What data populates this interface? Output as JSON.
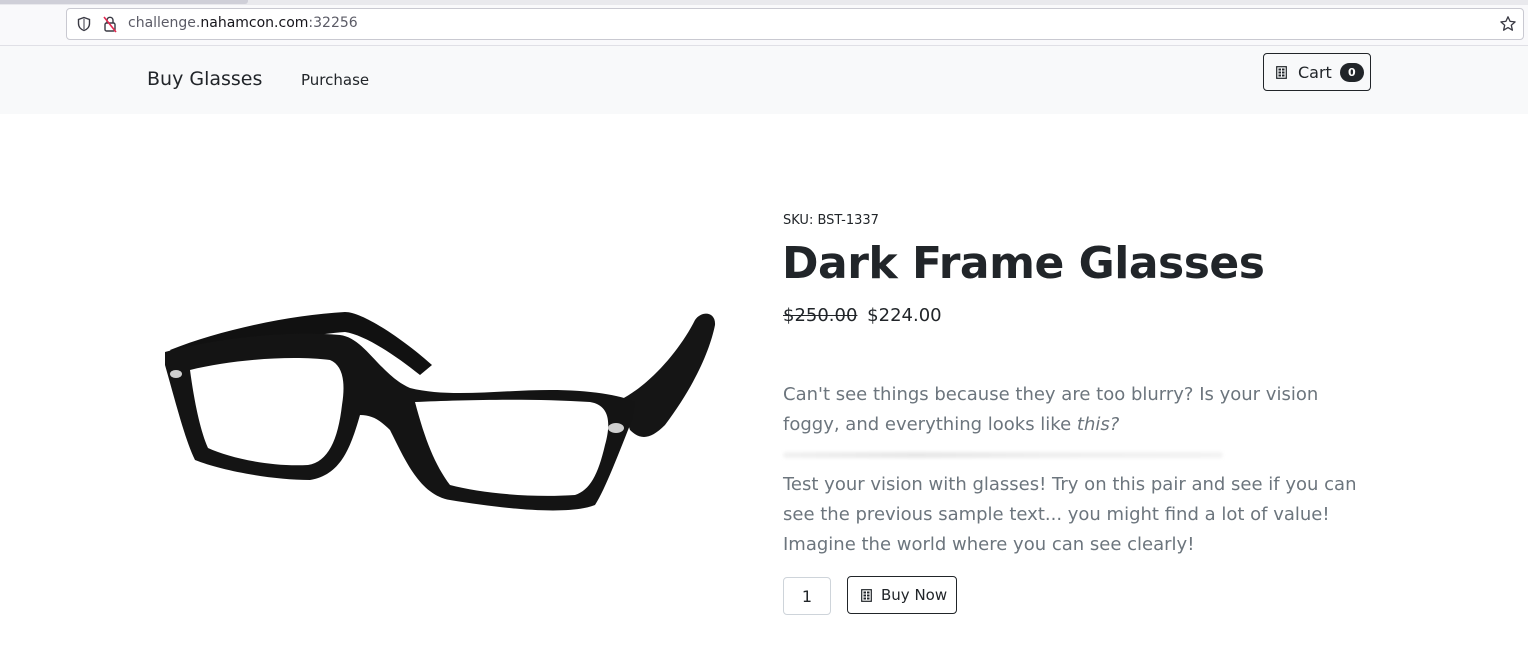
{
  "browser": {
    "url_prefix": "challenge.",
    "url_host": "nahamcon.com",
    "url_suffix": ":32256"
  },
  "navbar": {
    "brand": "Buy Glasses",
    "purchase_link": "Purchase",
    "cart_label": "Cart",
    "cart_count": "0"
  },
  "product": {
    "sku": "SKU: BST-1337",
    "title": "Dark Frame Glasses",
    "old_price": "$250.00",
    "price": "$224.00",
    "description_1_text": "Can't see things because they are too blurry? Is your vision foggy, and everything looks like ",
    "description_1_emph": "this?",
    "description_2": "Test your vision with glasses! Try on this pair and see if you can see the previous sample text... you might find a lot of value! Imagine the world where you can see clearly!",
    "quantity": "1",
    "buy_label": "Buy Now"
  },
  "colors": {
    "text": "#212529",
    "muted": "#6c757d",
    "navbar_bg": "#f8f9fa"
  },
  "icons": {
    "cart": "cart-icon",
    "buy": "cart-icon",
    "shield": "shield-icon",
    "lock": "insecure-lock-icon",
    "bookmark": "star-icon"
  }
}
